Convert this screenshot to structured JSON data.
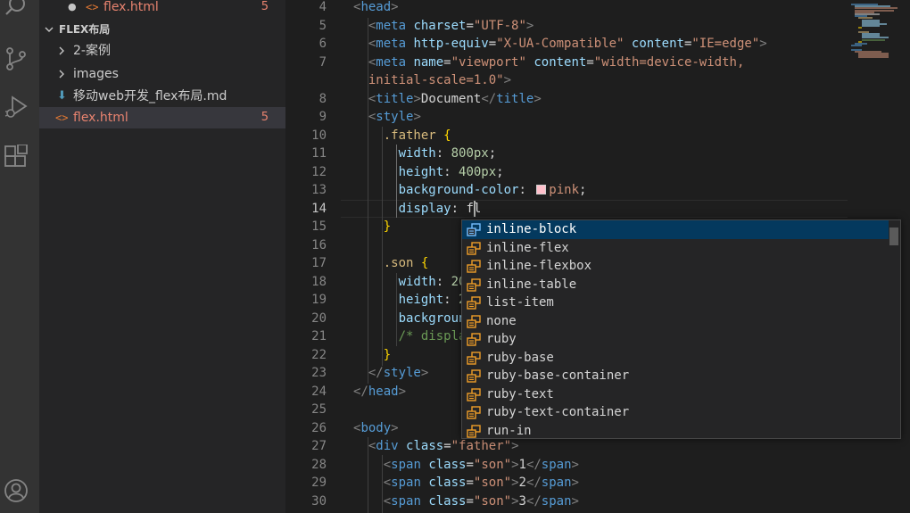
{
  "activity_bar": {
    "icons": [
      "search-icon",
      "source-control-icon",
      "run-debug-icon",
      "extensions-icon",
      "account-icon"
    ]
  },
  "explorer": {
    "open_editor": {
      "name": "flex.html",
      "badge": "5"
    },
    "folder": "FLEX布局",
    "items": [
      {
        "name": "2-案例",
        "type": "folder"
      },
      {
        "name": "images",
        "type": "folder"
      },
      {
        "name": "移动web开发_flex布局.md",
        "type": "markdown"
      },
      {
        "name": "flex.html",
        "type": "html",
        "badge": "5"
      }
    ]
  },
  "editor": {
    "active_line": "14",
    "lines": [
      {
        "n": "4",
        "tokens": [
          [
            "t-br",
            "<"
          ],
          [
            "t-tag",
            "head"
          ],
          [
            "t-br",
            ">"
          ]
        ]
      },
      {
        "n": "5",
        "tokens": [
          [
            "t-txt",
            "  "
          ],
          [
            "t-br",
            "<"
          ],
          [
            "t-tag",
            "meta"
          ],
          [
            "t-txt",
            " "
          ],
          [
            "t-attr",
            "charset"
          ],
          [
            "t-txt",
            "="
          ],
          [
            "t-str",
            "\"UTF-8\""
          ],
          [
            "t-br",
            ">"
          ]
        ]
      },
      {
        "n": "6",
        "tokens": [
          [
            "t-txt",
            "  "
          ],
          [
            "t-br",
            "<"
          ],
          [
            "t-tag",
            "meta"
          ],
          [
            "t-txt",
            " "
          ],
          [
            "t-attr",
            "http-equiv"
          ],
          [
            "t-txt",
            "="
          ],
          [
            "t-str",
            "\"X-UA-Compatible\""
          ],
          [
            "t-txt",
            " "
          ],
          [
            "t-attr",
            "content"
          ],
          [
            "t-txt",
            "="
          ],
          [
            "t-str",
            "\"IE=edge\""
          ],
          [
            "t-br",
            ">"
          ]
        ]
      },
      {
        "n": "7",
        "tokens": [
          [
            "t-txt",
            "  "
          ],
          [
            "t-br",
            "<"
          ],
          [
            "t-tag",
            "meta"
          ],
          [
            "t-txt",
            " "
          ],
          [
            "t-attr",
            "name"
          ],
          [
            "t-txt",
            "="
          ],
          [
            "t-str",
            "\"viewport\""
          ],
          [
            "t-txt",
            " "
          ],
          [
            "t-attr",
            "content"
          ],
          [
            "t-txt",
            "="
          ],
          [
            "t-str",
            "\"width=device-width,"
          ]
        ]
      },
      {
        "n": "",
        "tokens": [
          [
            "t-str",
            "  initial-scale=1.0\""
          ],
          [
            "t-br",
            ">"
          ]
        ]
      },
      {
        "n": "8",
        "tokens": [
          [
            "t-txt",
            "  "
          ],
          [
            "t-br",
            "<"
          ],
          [
            "t-tag",
            "title"
          ],
          [
            "t-br",
            ">"
          ],
          [
            "t-txt",
            "Document"
          ],
          [
            "t-br",
            "</"
          ],
          [
            "t-tag",
            "title"
          ],
          [
            "t-br",
            ">"
          ]
        ]
      },
      {
        "n": "9",
        "tokens": [
          [
            "t-txt",
            "  "
          ],
          [
            "t-br",
            "<"
          ],
          [
            "t-tag",
            "style"
          ],
          [
            "t-br",
            ">"
          ]
        ]
      },
      {
        "n": "10",
        "tokens": [
          [
            "t-txt",
            "    "
          ],
          [
            "t-sel",
            ".father"
          ],
          [
            "t-txt",
            " "
          ],
          [
            "t-brace",
            "{"
          ]
        ]
      },
      {
        "n": "11",
        "tokens": [
          [
            "t-txt",
            "      "
          ],
          [
            "t-prop",
            "width"
          ],
          [
            "t-txt",
            ": "
          ],
          [
            "t-num",
            "800px"
          ],
          [
            "t-txt",
            ";"
          ]
        ]
      },
      {
        "n": "12",
        "tokens": [
          [
            "t-txt",
            "      "
          ],
          [
            "t-prop",
            "height"
          ],
          [
            "t-txt",
            ": "
          ],
          [
            "t-num",
            "400px"
          ],
          [
            "t-txt",
            ";"
          ]
        ]
      },
      {
        "n": "13",
        "tokens": [
          [
            "t-txt",
            "      "
          ],
          [
            "t-prop",
            "background-color"
          ],
          [
            "t-txt",
            ": "
          ],
          [
            "swatch",
            ""
          ],
          [
            "t-str",
            "pink"
          ],
          [
            "t-txt",
            ";"
          ]
        ]
      },
      {
        "n": "14",
        "tokens": [
          [
            "t-txt",
            "      "
          ],
          [
            "t-prop",
            "display"
          ],
          [
            "t-txt",
            ": "
          ],
          [
            "t-txt",
            "fl"
          ]
        ]
      },
      {
        "n": "15",
        "tokens": [
          [
            "t-txt",
            "    "
          ],
          [
            "t-brace",
            "}"
          ]
        ]
      },
      {
        "n": "16",
        "tokens": []
      },
      {
        "n": "17",
        "tokens": [
          [
            "t-txt",
            "    "
          ],
          [
            "t-sel",
            ".son"
          ],
          [
            "t-txt",
            " "
          ],
          [
            "t-brace",
            "{"
          ]
        ]
      },
      {
        "n": "18",
        "tokens": [
          [
            "t-txt",
            "      "
          ],
          [
            "t-prop",
            "width"
          ],
          [
            "t-txt",
            ": "
          ],
          [
            "t-num",
            "20"
          ]
        ]
      },
      {
        "n": "19",
        "tokens": [
          [
            "t-txt",
            "      "
          ],
          [
            "t-prop",
            "height"
          ],
          [
            "t-txt",
            ": "
          ],
          [
            "t-num",
            "2"
          ]
        ]
      },
      {
        "n": "20",
        "tokens": [
          [
            "t-txt",
            "      "
          ],
          [
            "t-prop",
            "backgroun"
          ]
        ]
      },
      {
        "n": "21",
        "tokens": [
          [
            "t-txt",
            "      "
          ],
          [
            "t-com",
            "/* displa"
          ]
        ]
      },
      {
        "n": "22",
        "tokens": [
          [
            "t-txt",
            "    "
          ],
          [
            "t-brace",
            "}"
          ]
        ]
      },
      {
        "n": "23",
        "tokens": [
          [
            "t-txt",
            "  "
          ],
          [
            "t-br",
            "</"
          ],
          [
            "t-tag",
            "style"
          ],
          [
            "t-br",
            ">"
          ]
        ]
      },
      {
        "n": "24",
        "tokens": [
          [
            "t-br",
            "</"
          ],
          [
            "t-tag",
            "head"
          ],
          [
            "t-br",
            ">"
          ]
        ]
      },
      {
        "n": "25",
        "tokens": []
      },
      {
        "n": "26",
        "tokens": [
          [
            "t-br",
            "<"
          ],
          [
            "t-tag",
            "body"
          ],
          [
            "t-br",
            ">"
          ]
        ]
      },
      {
        "n": "27",
        "tokens": [
          [
            "t-txt",
            "  "
          ],
          [
            "t-br",
            "<"
          ],
          [
            "t-tag",
            "div"
          ],
          [
            "t-txt",
            " "
          ],
          [
            "t-attr",
            "class"
          ],
          [
            "t-txt",
            "="
          ],
          [
            "t-str",
            "\"father\""
          ],
          [
            "t-br",
            ">"
          ]
        ]
      },
      {
        "n": "28",
        "tokens": [
          [
            "t-txt",
            "    "
          ],
          [
            "t-br",
            "<"
          ],
          [
            "t-tag",
            "span"
          ],
          [
            "t-txt",
            " "
          ],
          [
            "t-attr",
            "class"
          ],
          [
            "t-txt",
            "="
          ],
          [
            "t-str",
            "\"son\""
          ],
          [
            "t-br",
            ">"
          ],
          [
            "t-txt",
            "1"
          ],
          [
            "t-br",
            "</"
          ],
          [
            "t-tag",
            "span"
          ],
          [
            "t-br",
            ">"
          ]
        ]
      },
      {
        "n": "29",
        "tokens": [
          [
            "t-txt",
            "    "
          ],
          [
            "t-br",
            "<"
          ],
          [
            "t-tag",
            "span"
          ],
          [
            "t-txt",
            " "
          ],
          [
            "t-attr",
            "class"
          ],
          [
            "t-txt",
            "="
          ],
          [
            "t-str",
            "\"son\""
          ],
          [
            "t-br",
            ">"
          ],
          [
            "t-txt",
            "2"
          ],
          [
            "t-br",
            "</"
          ],
          [
            "t-tag",
            "span"
          ],
          [
            "t-br",
            ">"
          ]
        ]
      },
      {
        "n": "30",
        "tokens": [
          [
            "t-txt",
            "    "
          ],
          [
            "t-br",
            "<"
          ],
          [
            "t-tag",
            "span"
          ],
          [
            "t-txt",
            " "
          ],
          [
            "t-attr",
            "class"
          ],
          [
            "t-txt",
            "="
          ],
          [
            "t-str",
            "\"son\""
          ],
          [
            "t-br",
            ">"
          ],
          [
            "t-txt",
            "3"
          ],
          [
            "t-br",
            "</"
          ],
          [
            "t-tag",
            "span"
          ],
          [
            "t-br",
            ">"
          ]
        ]
      }
    ]
  },
  "suggest": {
    "selected_index": 0,
    "items": [
      "inline-block",
      "inline-flex",
      "inline-flexbox",
      "inline-table",
      "list-item",
      "none",
      "ruby",
      "ruby-base",
      "ruby-base-container",
      "ruby-text",
      "ruby-text-container",
      "run-in"
    ]
  },
  "colors": {
    "accent": "#04395e",
    "error": "#e8836f",
    "html_icon": "#e37933",
    "markdown_icon": "#519aba"
  }
}
